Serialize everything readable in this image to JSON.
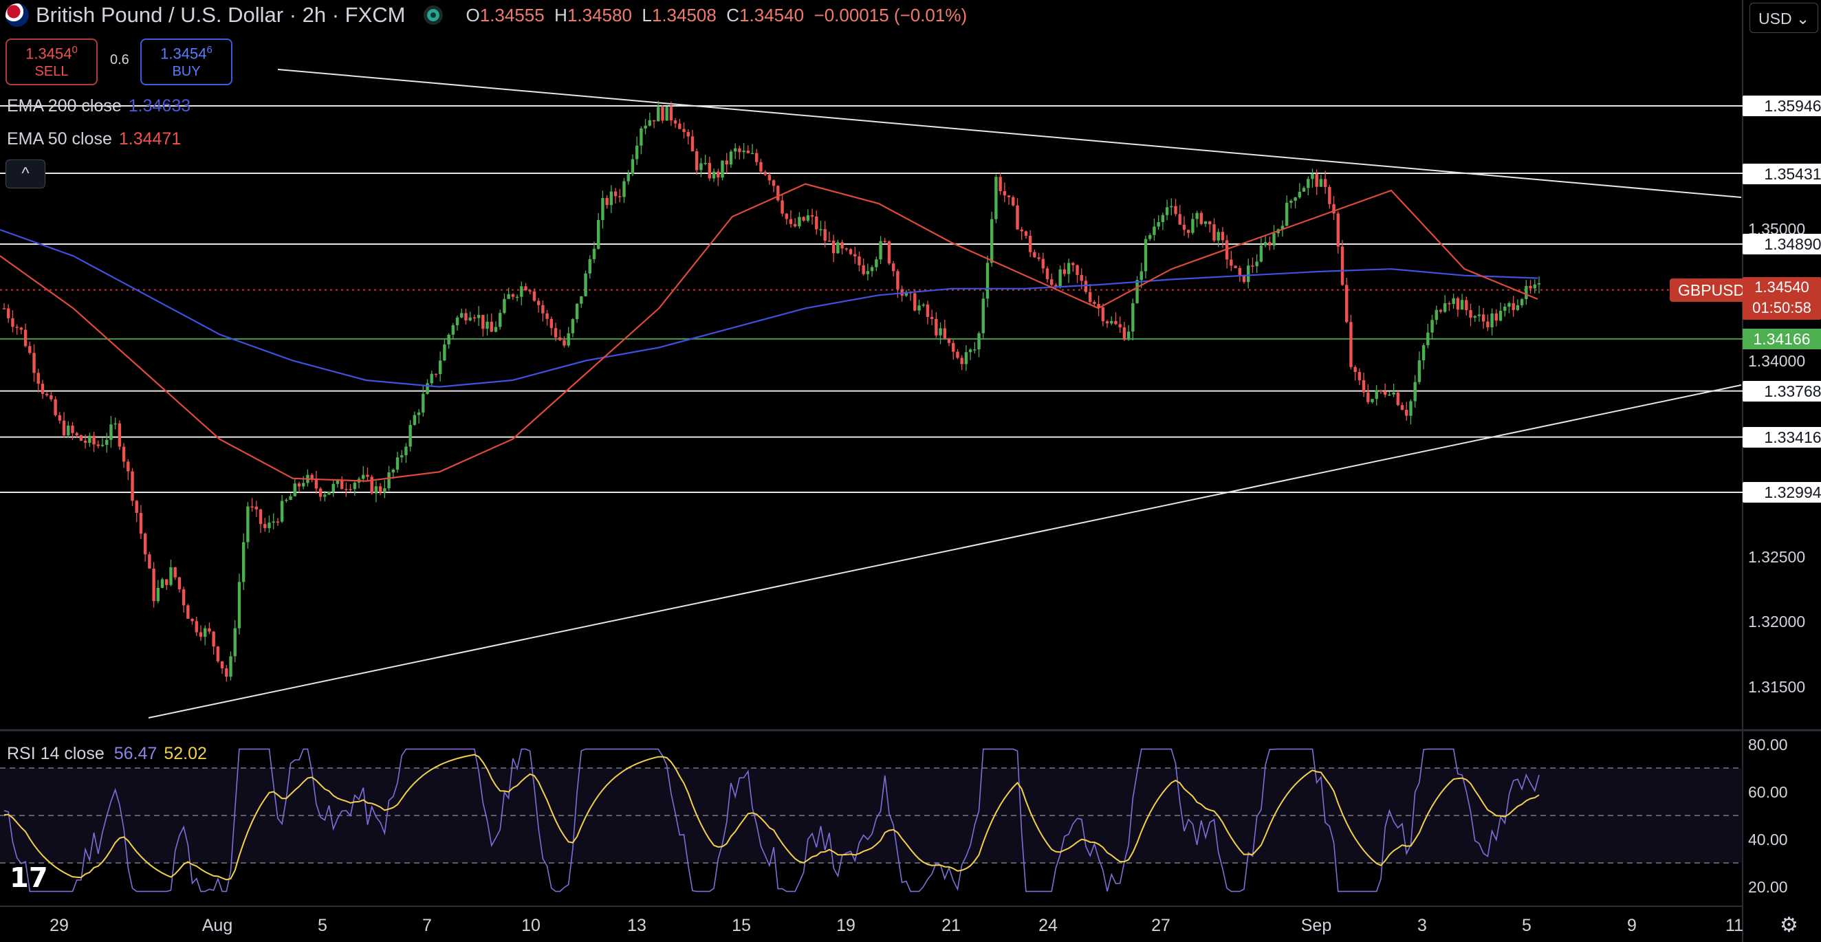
{
  "header": {
    "symbol_title": "British Pound / U.S. Dollar · 2h · FXCM",
    "o_label": "O",
    "o_value": "1.34555",
    "h_label": "H",
    "h_value": "1.34580",
    "l_label": "L",
    "l_value": "1.34508",
    "c_label": "C",
    "c_value": "1.34540",
    "change": "−0.00015 (−0.01%)"
  },
  "trade": {
    "sell_price_main": "1.3454",
    "sell_price_sup": "0",
    "sell_label": "SELL",
    "spread": "0.6",
    "buy_price_main": "1.3454",
    "buy_price_sup": "6",
    "buy_label": "BUY"
  },
  "indicators": {
    "ema200_label": "EMA 200 close",
    "ema200_value": "1.34633",
    "ema50_label": "EMA 50 close",
    "ema50_value": "1.34471",
    "collapse_glyph": "^"
  },
  "price_axis": {
    "currency": "USD",
    "ticks": [
      "1.35000",
      "1.34000",
      "1.32500",
      "1.32000",
      "1.31500"
    ],
    "level_labels": [
      "1.35946",
      "1.35431",
      "1.34890",
      "1.33768",
      "1.33416",
      "1.32994"
    ],
    "symbol_tag": "GBPUSD",
    "last_price": "1.34540",
    "countdown": "01:50:58",
    "green_level": "1.34166"
  },
  "rsi": {
    "label": "RSI 14 close",
    "value": "56.47",
    "ma_value": "52.02",
    "ticks": [
      "80.00",
      "60.00",
      "40.00",
      "20.00"
    ]
  },
  "time_axis": [
    "29",
    "Aug",
    "5",
    "7",
    "10",
    "13",
    "15",
    "19",
    "21",
    "24",
    "27",
    "Sep",
    "3",
    "5",
    "9",
    "11"
  ],
  "colors": {
    "up": "#4caf50",
    "down": "#ef5350",
    "ema200": "#3f51e0",
    "ema50": "#e04a3a",
    "rsi_line": "#7e6fd8",
    "rsi_ma": "#f2d24a",
    "last_price": "#c0392b"
  },
  "icons": {
    "settings": "gear-icon",
    "logo": "tradingview-logo"
  },
  "chart_data": {
    "type": "candlestick",
    "symbol": "GBPUSD",
    "interval": "2h",
    "ylim": [
      1.3125,
      1.362
    ],
    "horizontal_levels": [
      1.35946,
      1.35431,
      1.3489,
      1.34166,
      1.33768,
      1.33416,
      1.32994
    ],
    "last_price": 1.3454,
    "trendlines": [
      {
        "from": [
          "Jul 30",
          1.359
        ],
        "to": [
          "Sep 5",
          1.354
        ]
      },
      {
        "from": [
          "Jul 31",
          1.3125
        ],
        "to": [
          "Sep 5",
          1.337
        ]
      }
    ],
    "price_path": [
      1.344,
      1.342,
      1.338,
      1.335,
      1.334,
      1.3335,
      1.335,
      1.329,
      1.322,
      1.324,
      1.32,
      1.319,
      1.3155,
      1.329,
      1.327,
      1.329,
      1.331,
      1.33,
      1.3305,
      1.331,
      1.33,
      1.332,
      1.336,
      1.339,
      1.343,
      1.344,
      1.342,
      1.345,
      1.346,
      1.343,
      1.341,
      1.346,
      1.352,
      1.353,
      1.358,
      1.359,
      1.3585,
      1.355,
      1.354,
      1.356,
      1.3555,
      1.354,
      1.35,
      1.351,
      1.349,
      1.348,
      1.347,
      1.349,
      1.345,
      1.344,
      1.342,
      1.34,
      1.341,
      1.354,
      1.351,
      1.348,
      1.346,
      1.347,
      1.345,
      1.343,
      1.342,
      1.349,
      1.352,
      1.35,
      1.351,
      1.349,
      1.346,
      1.348,
      1.35,
      1.353,
      1.354,
      1.352,
      1.339,
      1.337,
      1.338,
      1.336,
      1.342,
      1.345,
      1.344,
      1.343,
      1.3435,
      1.345,
      1.3454
    ],
    "ema200": [
      1.35,
      1.348,
      1.345,
      1.342,
      1.34,
      1.3385,
      1.338,
      1.3385,
      1.34,
      1.341,
      1.3425,
      1.344,
      1.345,
      1.3455,
      1.3455,
      1.3458,
      1.3462,
      1.3465,
      1.3468,
      1.347,
      1.3465,
      1.3463
    ],
    "ema50": [
      1.348,
      1.344,
      1.339,
      1.334,
      1.331,
      1.3308,
      1.3315,
      1.334,
      1.339,
      1.344,
      1.351,
      1.3535,
      1.352,
      1.349,
      1.3465,
      1.344,
      1.347,
      1.349,
      1.351,
      1.353,
      1.347,
      1.3447
    ],
    "rsi": {
      "value": 56.47,
      "ma": 52.02,
      "ylim": [
        15,
        85
      ],
      "bands": [
        70,
        50,
        30
      ]
    }
  }
}
